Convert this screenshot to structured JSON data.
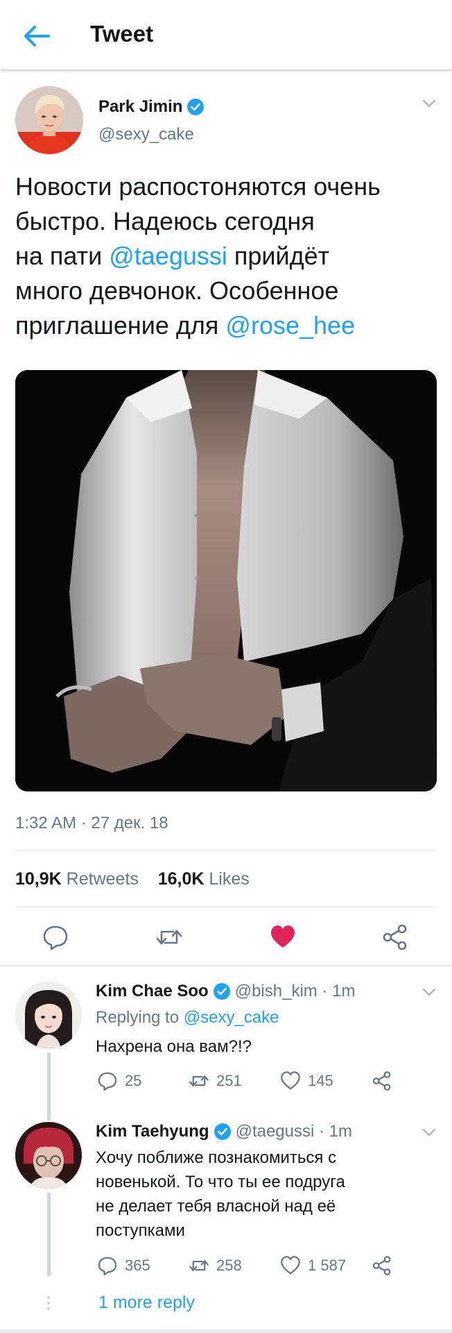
{
  "header": {
    "title": "Tweet"
  },
  "tweet": {
    "author_name": "Park Jimin",
    "author_handle": "@sexy_cake",
    "text_lines": [
      [
        "Новости распостоняются очень"
      ],
      [
        "быстро. Надеюсь сегодня"
      ],
      [
        "на пати ",
        "@taegussi",
        " прийдёт"
      ],
      [
        "много девчонок. Особенное"
      ],
      [
        "приглашение для ",
        "@rose_hee"
      ]
    ],
    "line1": "Новости распостоняются очень",
    "line2": "быстро. Надеюсь сегодня",
    "line3_prefix": "на пати ",
    "line3_mention": "@taegussi",
    "line3_suffix": " прийдёт",
    "line4": "много девчонок. Особенное",
    "line5_prefix": "приглашение для ",
    "line5_mention": "@rose_hee",
    "timestamp": "1:32 AM · 27 дек. 18",
    "retweets_count": "10,9K",
    "retweets_label": "Retweets",
    "likes_count": "16,0K",
    "likes_label": "Likes",
    "liked": true
  },
  "colors": {
    "accent": "#1da1f2",
    "like": "#e0245e",
    "secondary_text": "#657786",
    "primary_text": "#14171a"
  },
  "replies": [
    {
      "name": "Kim Chae Soo",
      "handle": "@bish_kim",
      "time": "1m",
      "meta": "@bish_kim · 1m",
      "replying_label": "Replying to",
      "replying_to": "@sexy_cake",
      "body_lines": [
        "Нахрена она вам?!?"
      ],
      "replies": "25",
      "retweets": "251",
      "likes": "145"
    },
    {
      "name": "Kim Taehyung",
      "handle": "@taegussi",
      "time": "1m",
      "meta": "@taegussi · 1m",
      "body_lines": [
        "Хочу поближе познакомиться с",
        "новенькой. То что ты ее подруга",
        "не делает тебя власной над её",
        "поступками"
      ],
      "replies": "365",
      "retweets": "258",
      "likes": "1 587"
    }
  ],
  "more_replies_label": "1 more reply",
  "icons": {
    "back": "back-arrow-icon",
    "verified": "verified-badge-icon",
    "caret": "chevron-down-icon",
    "reply": "reply-icon",
    "retweet": "retweet-icon",
    "like": "heart-icon",
    "share": "share-icon"
  }
}
